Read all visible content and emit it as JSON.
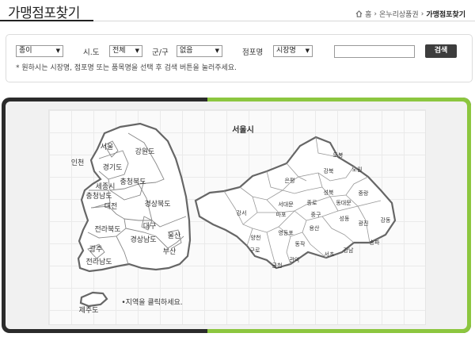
{
  "page": {
    "title": "가맹점포찾기",
    "breadcrumb": {
      "home": "홈",
      "parent": "온누리상품권",
      "current": "가맹점포찾기"
    }
  },
  "search": {
    "voucher_type": "종이",
    "sido_label": "시.도",
    "sido_value": "전체",
    "gungu_label": "군/구",
    "gungu_value": "없음",
    "store_label": "점포명",
    "store_type_value": "시장명",
    "button_label": "검색",
    "hint": "* 원하시는 시장명, 점포명 또는 품목명을 선택 후 검색 버튼을 눌러주세요."
  },
  "map": {
    "korea_regions": [
      "서울",
      "인천",
      "경기도",
      "강원도",
      "세종시",
      "충청북도",
      "충청남도",
      "대전",
      "경상북도",
      "대구",
      "전라북도",
      "경상남도",
      "울산",
      "부산",
      "광주",
      "전라남도",
      "제주도"
    ],
    "seoul_title": "서울시",
    "seoul_districts": [
      "도봉",
      "노원",
      "강북",
      "은평",
      "성북",
      "중랑",
      "종로",
      "동대문",
      "서대문",
      "강서",
      "마포",
      "중구",
      "성동",
      "광진",
      "강동",
      "양천",
      "영등포",
      "용산",
      "동작",
      "송파",
      "구로",
      "강남",
      "서초",
      "금천",
      "관악"
    ],
    "hint": "지역을 클릭하세요."
  },
  "colors": {
    "frame_dark": "#2b2b2b",
    "frame_green": "#8cc63f",
    "button": "#3d3d3d"
  }
}
